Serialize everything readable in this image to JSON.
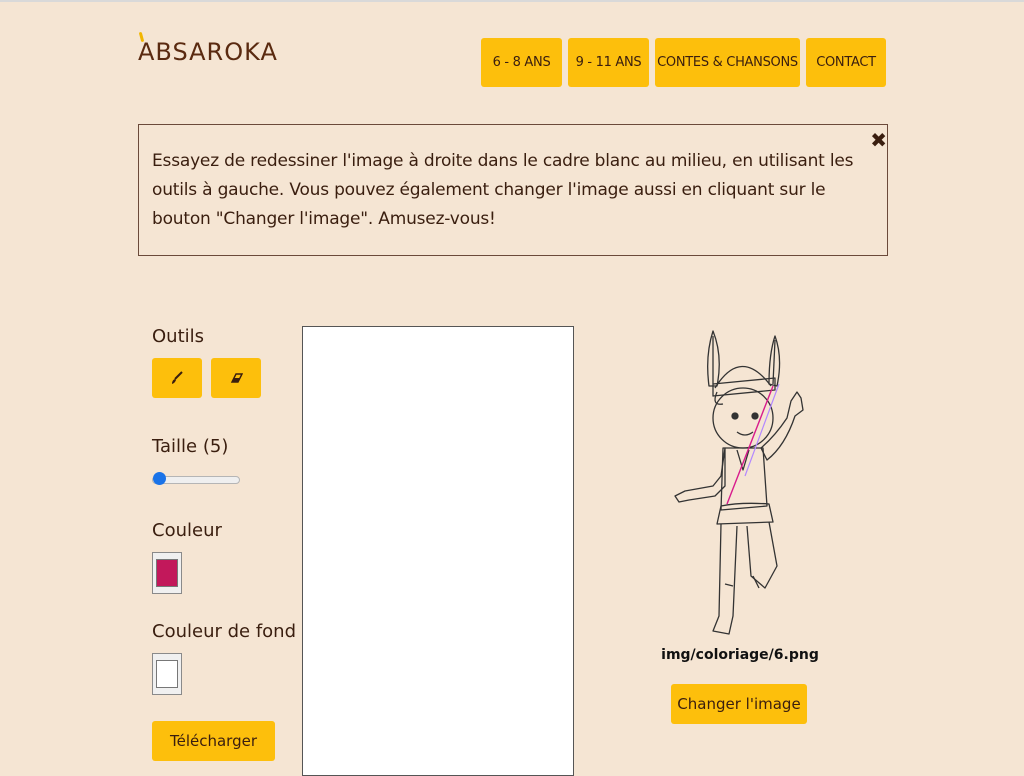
{
  "header": {
    "logo": "ABSAROKA",
    "nav": [
      "6 - 8 ANS",
      "9 - 11 ANS",
      "CONTES & CHANSONS",
      "CONTACT"
    ]
  },
  "alert": {
    "text": "Essayez de redessiner l'image à droite dans le cadre blanc au milieu, en utilisant les outils à gauche. Vous pouvez également changer l'image aussi en cliquant sur le bouton \"Changer l'image\". Amusez-vous!",
    "close": "✖"
  },
  "tools": {
    "title": "Outils",
    "size_label": "Taille (5)",
    "size_value": 5,
    "color_label": "Couleur",
    "color_value": "#c2185b",
    "bg_label": "Couleur de fond",
    "bg_value": "#ffffff",
    "download_label": "Télécharger"
  },
  "preview": {
    "path": "img/coloriage/6.png",
    "change_label": "Changer l'image"
  }
}
